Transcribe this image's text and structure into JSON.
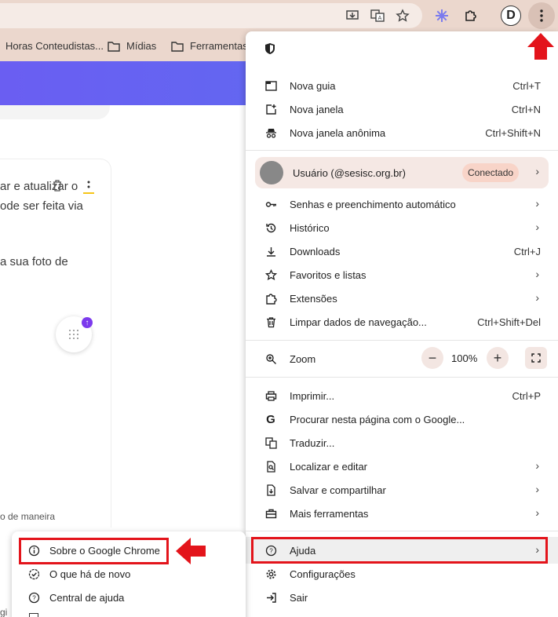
{
  "bookmarks": [
    {
      "label": "Horas Conteudistas...",
      "icon": "none"
    },
    {
      "label": "Mídias",
      "icon": "folder-icon"
    },
    {
      "label": "Ferramentas",
      "icon": "folder-icon"
    }
  ],
  "page": {
    "lines": [
      "ar e atualizar o",
      "ode ser feita via",
      "a sua foto de",
      "o de maneira"
    ],
    "bottom_fragment": "gi"
  },
  "menu": {
    "group1": [
      {
        "label": "Nova guia",
        "shortcut": "Ctrl+T",
        "icon": "new-tab-icon"
      },
      {
        "label": "Nova janela",
        "shortcut": "Ctrl+N",
        "icon": "new-window-icon"
      },
      {
        "label": "Nova janela anônima",
        "shortcut": "Ctrl+Shift+N",
        "icon": "incognito-icon"
      }
    ],
    "profile": {
      "name": "Usuário (@sesisc.org.br)",
      "status": "Conectado"
    },
    "group2": [
      {
        "label": "Senhas e preenchimento automático",
        "shortcut": "",
        "submenu": true,
        "icon": "key-icon"
      },
      {
        "label": "Histórico",
        "shortcut": "",
        "submenu": true,
        "icon": "history-icon"
      },
      {
        "label": "Downloads",
        "shortcut": "Ctrl+J",
        "submenu": false,
        "icon": "download-icon"
      },
      {
        "label": "Favoritos e listas",
        "shortcut": "",
        "submenu": true,
        "icon": "star-icon"
      },
      {
        "label": "Extensões",
        "shortcut": "",
        "submenu": true,
        "icon": "puzzle-icon"
      },
      {
        "label": "Limpar dados de navegação...",
        "shortcut": "Ctrl+Shift+Del",
        "submenu": false,
        "icon": "trash-icon"
      }
    ],
    "zoom": {
      "label": "Zoom",
      "value": "100%",
      "minus": "−",
      "plus": "+"
    },
    "group3": [
      {
        "label": "Imprimir...",
        "shortcut": "Ctrl+P",
        "submenu": false,
        "icon": "print-icon"
      },
      {
        "label": "Procurar nesta página com o Google...",
        "shortcut": "",
        "submenu": false,
        "icon": "google-icon"
      },
      {
        "label": "Traduzir...",
        "shortcut": "",
        "submenu": false,
        "icon": "translate-icon"
      },
      {
        "label": "Localizar e editar",
        "shortcut": "",
        "submenu": true,
        "icon": "find-icon"
      },
      {
        "label": "Salvar e compartilhar",
        "shortcut": "",
        "submenu": true,
        "icon": "save-icon"
      },
      {
        "label": "Mais ferramentas",
        "shortcut": "",
        "submenu": true,
        "icon": "toolbox-icon"
      }
    ],
    "group4": [
      {
        "label": "Ajuda",
        "shortcut": "",
        "submenu": true,
        "icon": "help-icon"
      },
      {
        "label": "Configurações",
        "shortcut": "",
        "submenu": false,
        "icon": "settings-icon"
      },
      {
        "label": "Sair",
        "shortcut": "",
        "submenu": false,
        "icon": "exit-icon"
      }
    ]
  },
  "help_submenu": [
    {
      "label": "Sobre o Google Chrome",
      "icon": "info-icon"
    },
    {
      "label": "O que há de novo",
      "icon": "new-badge-icon"
    },
    {
      "label": "Central de ajuda",
      "icon": "help-icon"
    }
  ],
  "colors": {
    "highlight": "#e3141b",
    "toolbar": "#ebd7cd",
    "page_band": "#6366f1"
  }
}
